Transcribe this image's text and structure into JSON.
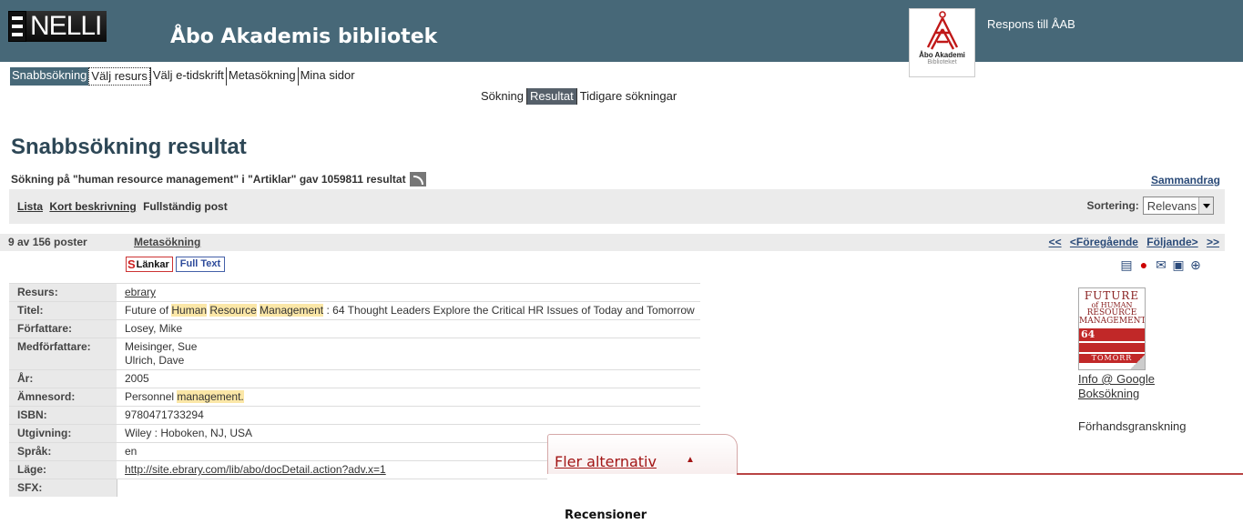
{
  "header": {
    "logo_text": "NELLI",
    "library_title": "Åbo Akademis bibliotek",
    "aa_logo_line1": "Åbo Akademi",
    "aa_logo_line2": "Biblioteket",
    "feedback_link": "Respons till ÅAB",
    "bg_color": "#476878"
  },
  "nav_main": [
    "Snabbsökning",
    "Välj resurs",
    "Välj e-tidskrift",
    "Metasökning",
    "Mina sidor"
  ],
  "nav_sub": [
    "Sökning",
    "Resultat",
    "Tidigare sökningar"
  ],
  "page_title": "Snabbsökning resultat",
  "search_info": "Sökning på \"human resource management\" i \"Artiklar\" gav 1059811 resultat",
  "summary_link": "Sammandrag",
  "views": {
    "list": "Lista",
    "short": "Kort beskrivning",
    "full": "Fullständig post"
  },
  "sort": {
    "label": "Sortering:",
    "value": "Relevans"
  },
  "record_bar": {
    "count": "9 av 156 poster",
    "meta": "Metasökning",
    "first": "<<",
    "prev": "<Föregående",
    "next": "Följande>",
    "last": ">>"
  },
  "buttons": {
    "links": "Länkar",
    "fulltext": "Full Text"
  },
  "record": {
    "labels": {
      "resource": "Resurs:",
      "title": "Titel:",
      "author": "Författare:",
      "coauthor": "Medförfattare:",
      "year": "År:",
      "subject": "Ämnesord:",
      "isbn": "ISBN:",
      "publication": "Utgivning:",
      "language": "Språk:",
      "location": "Läge:",
      "sfx": "SFX:"
    },
    "resource": "ebrary",
    "title_parts": [
      "Future of ",
      "Human",
      " ",
      "Resource",
      " ",
      "Management",
      " : 64 Thought Leaders Explore the Critical HR Issues of Today and Tomorrow"
    ],
    "author": "Losey, Mike",
    "coauthor1": "Meisinger, Sue",
    "coauthor2": "Ulrich, Dave",
    "year": "2005",
    "subject_pre": "Personnel ",
    "subject_mark": "management.",
    "isbn": "9780471733294",
    "publication": "Wiley :  Hoboken, NJ, USA",
    "language": "en",
    "location": "http://site.ebrary.com/lib/abo/docDetail.action?adv.x=1"
  },
  "cover": {
    "line1": "FUTURE",
    "line2": "of HUMAN",
    "line3": "RESOURCE",
    "line4": "MANAGEMENT",
    "number": "64",
    "tomorrow": "TOMORR"
  },
  "sidebar": {
    "google1": "Info @ Google",
    "google2": "Boksökning",
    "preview": "Förhandsgranskning"
  },
  "more_options": {
    "tab_label": "Fler alternativ",
    "reviews_heading": "Recensioner"
  },
  "colors": {
    "highlight": "#fbe7a7",
    "accent_red": "#a21515",
    "link_blue": "#2a4a78"
  }
}
